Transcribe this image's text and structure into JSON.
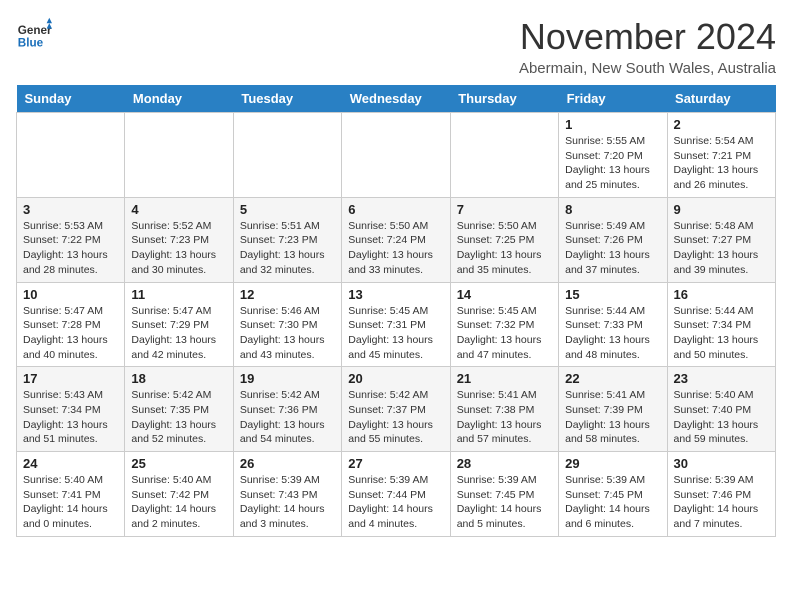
{
  "header": {
    "logo": {
      "general": "General",
      "blue": "Blue"
    },
    "title": "November 2024",
    "location": "Abermain, New South Wales, Australia"
  },
  "weekdays": [
    "Sunday",
    "Monday",
    "Tuesday",
    "Wednesday",
    "Thursday",
    "Friday",
    "Saturday"
  ],
  "weeks": [
    [
      {
        "day": "",
        "info": ""
      },
      {
        "day": "",
        "info": ""
      },
      {
        "day": "",
        "info": ""
      },
      {
        "day": "",
        "info": ""
      },
      {
        "day": "",
        "info": ""
      },
      {
        "day": "1",
        "info": "Sunrise: 5:55 AM\nSunset: 7:20 PM\nDaylight: 13 hours\nand 25 minutes."
      },
      {
        "day": "2",
        "info": "Sunrise: 5:54 AM\nSunset: 7:21 PM\nDaylight: 13 hours\nand 26 minutes."
      }
    ],
    [
      {
        "day": "3",
        "info": "Sunrise: 5:53 AM\nSunset: 7:22 PM\nDaylight: 13 hours\nand 28 minutes."
      },
      {
        "day": "4",
        "info": "Sunrise: 5:52 AM\nSunset: 7:23 PM\nDaylight: 13 hours\nand 30 minutes."
      },
      {
        "day": "5",
        "info": "Sunrise: 5:51 AM\nSunset: 7:23 PM\nDaylight: 13 hours\nand 32 minutes."
      },
      {
        "day": "6",
        "info": "Sunrise: 5:50 AM\nSunset: 7:24 PM\nDaylight: 13 hours\nand 33 minutes."
      },
      {
        "day": "7",
        "info": "Sunrise: 5:50 AM\nSunset: 7:25 PM\nDaylight: 13 hours\nand 35 minutes."
      },
      {
        "day": "8",
        "info": "Sunrise: 5:49 AM\nSunset: 7:26 PM\nDaylight: 13 hours\nand 37 minutes."
      },
      {
        "day": "9",
        "info": "Sunrise: 5:48 AM\nSunset: 7:27 PM\nDaylight: 13 hours\nand 39 minutes."
      }
    ],
    [
      {
        "day": "10",
        "info": "Sunrise: 5:47 AM\nSunset: 7:28 PM\nDaylight: 13 hours\nand 40 minutes."
      },
      {
        "day": "11",
        "info": "Sunrise: 5:47 AM\nSunset: 7:29 PM\nDaylight: 13 hours\nand 42 minutes."
      },
      {
        "day": "12",
        "info": "Sunrise: 5:46 AM\nSunset: 7:30 PM\nDaylight: 13 hours\nand 43 minutes."
      },
      {
        "day": "13",
        "info": "Sunrise: 5:45 AM\nSunset: 7:31 PM\nDaylight: 13 hours\nand 45 minutes."
      },
      {
        "day": "14",
        "info": "Sunrise: 5:45 AM\nSunset: 7:32 PM\nDaylight: 13 hours\nand 47 minutes."
      },
      {
        "day": "15",
        "info": "Sunrise: 5:44 AM\nSunset: 7:33 PM\nDaylight: 13 hours\nand 48 minutes."
      },
      {
        "day": "16",
        "info": "Sunrise: 5:44 AM\nSunset: 7:34 PM\nDaylight: 13 hours\nand 50 minutes."
      }
    ],
    [
      {
        "day": "17",
        "info": "Sunrise: 5:43 AM\nSunset: 7:34 PM\nDaylight: 13 hours\nand 51 minutes."
      },
      {
        "day": "18",
        "info": "Sunrise: 5:42 AM\nSunset: 7:35 PM\nDaylight: 13 hours\nand 52 minutes."
      },
      {
        "day": "19",
        "info": "Sunrise: 5:42 AM\nSunset: 7:36 PM\nDaylight: 13 hours\nand 54 minutes."
      },
      {
        "day": "20",
        "info": "Sunrise: 5:42 AM\nSunset: 7:37 PM\nDaylight: 13 hours\nand 55 minutes."
      },
      {
        "day": "21",
        "info": "Sunrise: 5:41 AM\nSunset: 7:38 PM\nDaylight: 13 hours\nand 57 minutes."
      },
      {
        "day": "22",
        "info": "Sunrise: 5:41 AM\nSunset: 7:39 PM\nDaylight: 13 hours\nand 58 minutes."
      },
      {
        "day": "23",
        "info": "Sunrise: 5:40 AM\nSunset: 7:40 PM\nDaylight: 13 hours\nand 59 minutes."
      }
    ],
    [
      {
        "day": "24",
        "info": "Sunrise: 5:40 AM\nSunset: 7:41 PM\nDaylight: 14 hours\nand 0 minutes."
      },
      {
        "day": "25",
        "info": "Sunrise: 5:40 AM\nSunset: 7:42 PM\nDaylight: 14 hours\nand 2 minutes."
      },
      {
        "day": "26",
        "info": "Sunrise: 5:39 AM\nSunset: 7:43 PM\nDaylight: 14 hours\nand 3 minutes."
      },
      {
        "day": "27",
        "info": "Sunrise: 5:39 AM\nSunset: 7:44 PM\nDaylight: 14 hours\nand 4 minutes."
      },
      {
        "day": "28",
        "info": "Sunrise: 5:39 AM\nSunset: 7:45 PM\nDaylight: 14 hours\nand 5 minutes."
      },
      {
        "day": "29",
        "info": "Sunrise: 5:39 AM\nSunset: 7:45 PM\nDaylight: 14 hours\nand 6 minutes."
      },
      {
        "day": "30",
        "info": "Sunrise: 5:39 AM\nSunset: 7:46 PM\nDaylight: 14 hours\nand 7 minutes."
      }
    ]
  ]
}
